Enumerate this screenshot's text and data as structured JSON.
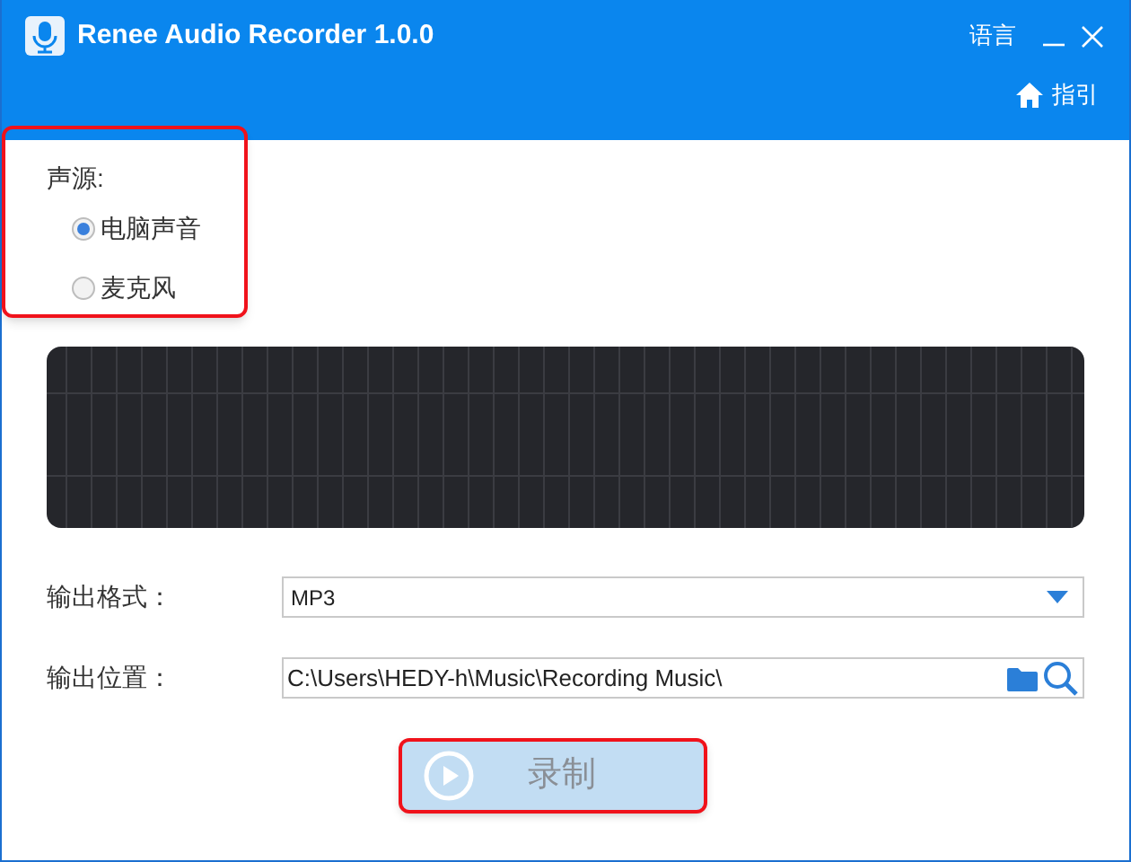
{
  "window": {
    "title": "Renee Audio Recorder 1.0.0",
    "language": "语言"
  },
  "toolbar": {
    "guide": "指引"
  },
  "source": {
    "label": "声源:",
    "highlighted": true,
    "options": [
      {
        "label": "电脑声音",
        "selected": true
      },
      {
        "label": "麦克风",
        "selected": false
      }
    ]
  },
  "output_format": {
    "label": "输出格式：",
    "value": "MP3"
  },
  "output_location": {
    "label": "输出位置：",
    "value": "C:\\Users\\HEDY-h\\Music\\Recording Music\\"
  },
  "record_button": {
    "label": "录制",
    "disabled": true,
    "highlighted": true
  }
}
